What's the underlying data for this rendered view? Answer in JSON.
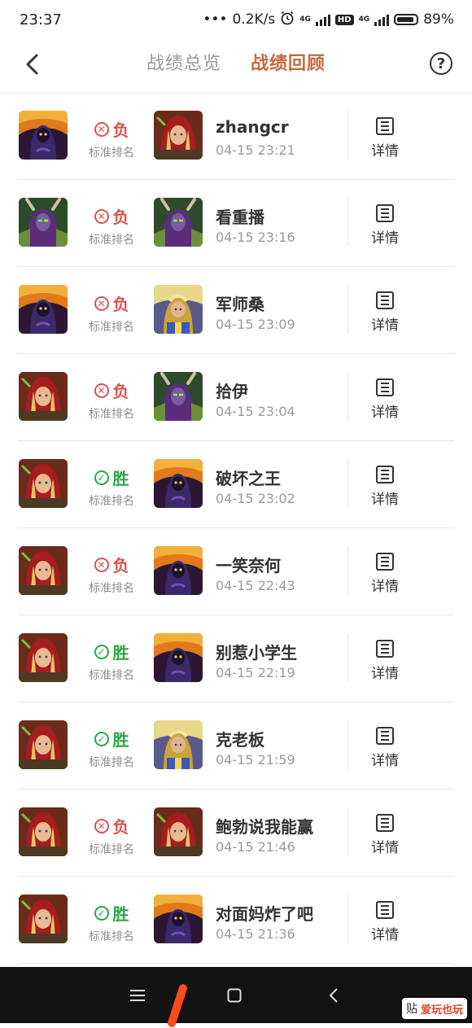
{
  "status": {
    "time": "23:37",
    "speed": "0.2K/s",
    "net1": "4G",
    "hd": "HD",
    "net2": "4G",
    "battery": "89%"
  },
  "header": {
    "tab_overview": "战绩总览",
    "tab_review": "战绩回顾",
    "help": "?"
  },
  "colors": {
    "accent": "#c46a3c",
    "lose": "#d9534f",
    "win": "#28a745"
  },
  "labels": {
    "detail": "详情"
  },
  "matches": [
    {
      "result": "负",
      "outcome": "lose",
      "mode": "标准排名",
      "opponent": "zhangcr",
      "time": "04-15 23:21",
      "my_hero": "warlock",
      "opp_hero": "hunter"
    },
    {
      "result": "负",
      "outcome": "lose",
      "mode": "标准排名",
      "opponent": "看重播",
      "time": "04-15 23:16",
      "my_hero": "demon-hunter",
      "opp_hero": "demon-hunter"
    },
    {
      "result": "负",
      "outcome": "lose",
      "mode": "标准排名",
      "opponent": "军师桑",
      "time": "04-15 23:09",
      "my_hero": "warlock",
      "opp_hero": "paladin"
    },
    {
      "result": "负",
      "outcome": "lose",
      "mode": "标准排名",
      "opponent": "拾伊",
      "time": "04-15 23:04",
      "my_hero": "hunter",
      "opp_hero": "demon-hunter"
    },
    {
      "result": "胜",
      "outcome": "win",
      "mode": "标准排名",
      "opponent": "破坏之王",
      "time": "04-15 23:02",
      "my_hero": "hunter",
      "opp_hero": "warlock"
    },
    {
      "result": "负",
      "outcome": "lose",
      "mode": "标准排名",
      "opponent": "一笑奈何",
      "time": "04-15 22:43",
      "my_hero": "hunter",
      "opp_hero": "warlock"
    },
    {
      "result": "胜",
      "outcome": "win",
      "mode": "标准排名",
      "opponent": "别惹小学生",
      "time": "04-15 22:19",
      "my_hero": "hunter",
      "opp_hero": "warlock"
    },
    {
      "result": "胜",
      "outcome": "win",
      "mode": "标准排名",
      "opponent": "克老板",
      "time": "04-15 21:59",
      "my_hero": "hunter",
      "opp_hero": "paladin"
    },
    {
      "result": "负",
      "outcome": "lose",
      "mode": "标准排名",
      "opponent": "鲍勃说我能赢",
      "time": "04-15 21:46",
      "my_hero": "hunter",
      "opp_hero": "hunter"
    },
    {
      "result": "胜",
      "outcome": "win",
      "mode": "标准排名",
      "opponent": "对面妈炸了吧",
      "time": "04-15 21:36",
      "my_hero": "hunter",
      "opp_hero": "warlock"
    }
  ],
  "watermark": {
    "badge": "贴",
    "text": "爱玩也玩"
  }
}
